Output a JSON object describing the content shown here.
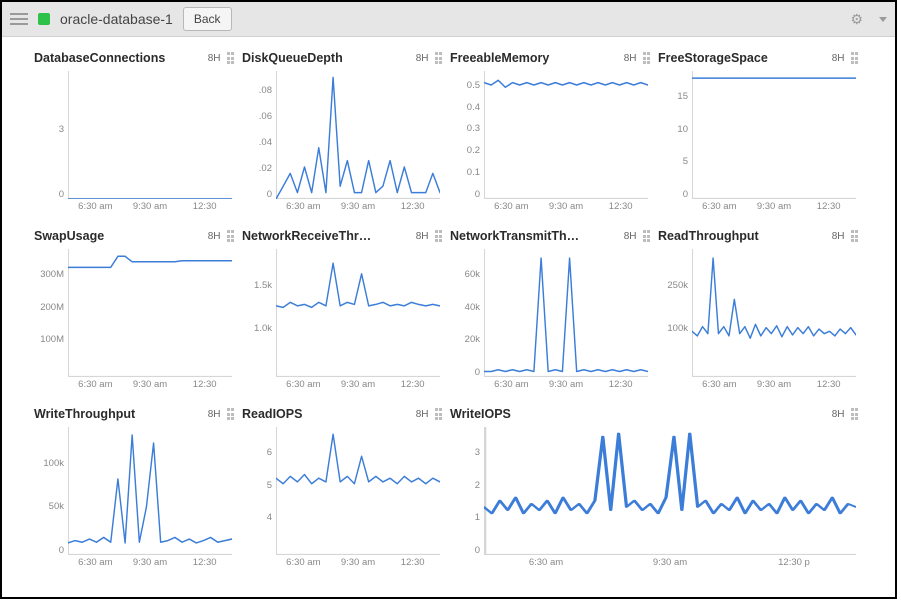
{
  "header": {
    "title": "oracle-database-1",
    "back_label": "Back"
  },
  "defaults": {
    "range_label": "8H",
    "x_ticks": [
      "6:30 am",
      "9:30 am",
      "12:30"
    ]
  },
  "chart_data": [
    {
      "id": "dbconn",
      "title": "DatabaseConnections",
      "type": "line",
      "xlabel": "",
      "ylabel": "",
      "ylim": [
        0,
        3
      ],
      "y_ticks": [
        "0",
        "3"
      ],
      "x_ticks": [
        "6:30 am",
        "9:30 am",
        "12:30"
      ],
      "x": [
        0,
        1,
        2,
        3,
        4,
        5,
        6,
        7,
        8,
        9,
        10,
        11,
        12,
        13,
        14,
        15,
        16,
        17,
        18,
        19,
        20,
        21,
        22,
        23
      ],
      "values": [
        0,
        0,
        0,
        0,
        0,
        0,
        0,
        0,
        0,
        0,
        0,
        0,
        0,
        0,
        0,
        0,
        0,
        0,
        0,
        0,
        0,
        0,
        0,
        0
      ]
    },
    {
      "id": "dqd",
      "title": "DiskQueueDepth",
      "type": "line",
      "xlabel": "",
      "ylabel": "",
      "ylim": [
        0,
        0.1
      ],
      "y_ticks": [
        "0",
        ".02",
        ".04",
        ".06",
        ".08"
      ],
      "x_ticks": [
        "6:30 am",
        "9:30 am",
        "12:30"
      ],
      "x": [
        0,
        1,
        2,
        3,
        4,
        5,
        6,
        7,
        8,
        9,
        10,
        11,
        12,
        13,
        14,
        15,
        16,
        17,
        18,
        19,
        20,
        21,
        22,
        23
      ],
      "values": [
        0.0,
        0.01,
        0.02,
        0.005,
        0.025,
        0.005,
        0.04,
        0.005,
        0.095,
        0.01,
        0.03,
        0.005,
        0.005,
        0.03,
        0.005,
        0.01,
        0.03,
        0.005,
        0.025,
        0.005,
        0.005,
        0.005,
        0.02,
        0.005
      ]
    },
    {
      "id": "freemem",
      "title": "FreeableMemory",
      "type": "line",
      "xlabel": "",
      "ylabel": "",
      "ylim": [
        0,
        0.55
      ],
      "y_ticks": [
        "0",
        "0.1",
        "0.2",
        "0.3",
        "0.4",
        "0.5"
      ],
      "x_ticks": [
        "6:30 am",
        "9:30 am",
        "12:30"
      ],
      "x": [
        0,
        1,
        2,
        3,
        4,
        5,
        6,
        7,
        8,
        9,
        10,
        11,
        12,
        13,
        14,
        15,
        16,
        17,
        18,
        19,
        20,
        21,
        22,
        23
      ],
      "values": [
        0.5,
        0.49,
        0.51,
        0.48,
        0.5,
        0.49,
        0.5,
        0.49,
        0.5,
        0.49,
        0.5,
        0.49,
        0.5,
        0.49,
        0.5,
        0.49,
        0.5,
        0.49,
        0.5,
        0.49,
        0.5,
        0.49,
        0.5,
        0.49
      ]
    },
    {
      "id": "freestor",
      "title": "FreeStorageSpace",
      "type": "line",
      "xlabel": "",
      "ylabel": "",
      "ylim": [
        0,
        18
      ],
      "y_ticks": [
        "0",
        "5",
        "10",
        "15"
      ],
      "x_ticks": [
        "6:30 am",
        "9:30 am",
        "12:30"
      ],
      "x": [
        0,
        1,
        2,
        3,
        4,
        5,
        6,
        7,
        8,
        9,
        10,
        11,
        12,
        13,
        14,
        15,
        16,
        17,
        18,
        19,
        20,
        21,
        22,
        23
      ],
      "values": [
        17,
        17,
        17,
        17,
        17,
        17,
        17,
        17,
        17,
        17,
        17,
        17,
        17,
        17,
        17,
        17,
        17,
        17,
        17,
        17,
        17,
        17,
        17,
        17
      ]
    },
    {
      "id": "swap",
      "title": "SwapUsage",
      "type": "line",
      "xlabel": "",
      "ylabel": "",
      "ylim": [
        0,
        350000000
      ],
      "y_ticks": [
        "",
        "100M",
        "200M",
        "300M"
      ],
      "x_ticks": [
        "6:30 am",
        "9:30 am",
        "12:30"
      ],
      "x": [
        0,
        1,
        2,
        3,
        4,
        5,
        6,
        7,
        8,
        9,
        10,
        11,
        12,
        13,
        14,
        15,
        16,
        17,
        18,
        19,
        20,
        21,
        22,
        23
      ],
      "values": [
        300000000,
        300000000,
        300000000,
        300000000,
        300000000,
        300000000,
        300000000,
        330000000,
        330000000,
        315000000,
        315000000,
        315000000,
        315000000,
        315000000,
        315000000,
        315000000,
        318000000,
        318000000,
        318000000,
        318000000,
        318000000,
        318000000,
        318000000,
        318000000
      ]
    },
    {
      "id": "netrx",
      "title": "NetworkReceiveThr…",
      "type": "line",
      "xlabel": "",
      "ylabel": "",
      "ylim": [
        0,
        1800
      ],
      "y_ticks": [
        "",
        "1.0k",
        "1.5k"
      ],
      "x_ticks": [
        "6:30 am",
        "9:30 am",
        "12:30"
      ],
      "x": [
        0,
        1,
        2,
        3,
        4,
        5,
        6,
        7,
        8,
        9,
        10,
        11,
        12,
        13,
        14,
        15,
        16,
        17,
        18,
        19,
        20,
        21,
        22,
        23
      ],
      "values": [
        1000,
        980,
        1050,
        1000,
        1020,
        980,
        1050,
        1000,
        1600,
        1000,
        1050,
        1020,
        1450,
        1000,
        1020,
        1050,
        1000,
        1020,
        1000,
        1050,
        1020,
        1000,
        1020,
        1000
      ]
    },
    {
      "id": "nettx",
      "title": "NetworkTransmitTh…",
      "type": "line",
      "xlabel": "",
      "ylabel": "",
      "ylim": [
        0,
        70000
      ],
      "y_ticks": [
        "0",
        "20k",
        "40k",
        "60k"
      ],
      "x_ticks": [
        "6:30 am",
        "9:30 am",
        "12:30"
      ],
      "x": [
        0,
        1,
        2,
        3,
        4,
        5,
        6,
        7,
        8,
        9,
        10,
        11,
        12,
        13,
        14,
        15,
        16,
        17,
        18,
        19,
        20,
        21,
        22,
        23
      ],
      "values": [
        3000,
        3000,
        4000,
        3000,
        4000,
        3000,
        4000,
        3000,
        65000,
        3000,
        4000,
        3000,
        65000,
        3000,
        4000,
        3000,
        4000,
        3000,
        4000,
        3000,
        4000,
        3000,
        4000,
        3000
      ]
    },
    {
      "id": "readtp",
      "title": "ReadThroughput",
      "type": "line",
      "xlabel": "",
      "ylabel": "",
      "ylim": [
        0,
        280000
      ],
      "y_ticks": [
        "",
        "100k",
        "250k"
      ],
      "x_ticks": [
        "6:30 am",
        "9:30 am",
        "12:30"
      ],
      "x": [
        0,
        1,
        2,
        3,
        4,
        5,
        6,
        7,
        8,
        9,
        10,
        11,
        12,
        13,
        14,
        15,
        16,
        17,
        18,
        19,
        20,
        21,
        22,
        23,
        24,
        25,
        26,
        27,
        28,
        29,
        30,
        31
      ],
      "values": [
        100000,
        90000,
        110000,
        95000,
        260000,
        95000,
        110000,
        90000,
        170000,
        95000,
        110000,
        85000,
        115000,
        90000,
        108000,
        95000,
        112000,
        88000,
        110000,
        92000,
        108000,
        95000,
        110000,
        90000,
        105000,
        95000,
        100000,
        90000,
        105000,
        95000,
        108000,
        92000
      ]
    },
    {
      "id": "writetp",
      "title": "WriteThroughput",
      "type": "line",
      "xlabel": "",
      "ylabel": "",
      "ylim": [
        0,
        160000
      ],
      "y_ticks": [
        "0",
        "50k",
        "100k"
      ],
      "x_ticks": [
        "6:30 am",
        "9:30 am",
        "12:30"
      ],
      "x": [
        0,
        1,
        2,
        3,
        4,
        5,
        6,
        7,
        8,
        9,
        10,
        11,
        12,
        13,
        14,
        15,
        16,
        17,
        18,
        19,
        20,
        21,
        22,
        23
      ],
      "values": [
        15000,
        18000,
        16000,
        20000,
        16000,
        22000,
        16000,
        95000,
        15000,
        150000,
        16000,
        60000,
        140000,
        16000,
        18000,
        22000,
        16000,
        20000,
        15000,
        18000,
        22000,
        16000,
        18000,
        20000
      ]
    },
    {
      "id": "readiops",
      "title": "ReadIOPS",
      "type": "line",
      "xlabel": "",
      "ylabel": "",
      "ylim": [
        0,
        7
      ],
      "y_ticks": [
        "",
        "4",
        "5",
        "6"
      ],
      "x_ticks": [
        "6:30 am",
        "9:30 am",
        "12:30"
      ],
      "x": [
        0,
        1,
        2,
        3,
        4,
        5,
        6,
        7,
        8,
        9,
        10,
        11,
        12,
        13,
        14,
        15,
        16,
        17,
        18,
        19,
        20,
        21,
        22,
        23
      ],
      "values": [
        4.2,
        3.9,
        4.3,
        4.0,
        4.4,
        3.9,
        4.2,
        4.0,
        6.6,
        4.0,
        4.3,
        3.9,
        5.4,
        4.0,
        4.3,
        4.0,
        4.2,
        3.9,
        4.3,
        4.0,
        4.2,
        3.9,
        4.2,
        4.0
      ]
    },
    {
      "id": "writeiops",
      "title": "WriteIOPS",
      "type": "line",
      "xlabel": "",
      "ylabel": "",
      "ylim": [
        0,
        4
      ],
      "y_ticks": [
        "0",
        "1",
        "2",
        "3"
      ],
      "x_ticks": [
        "6:30 am",
        "9:30 am",
        "12:30 p"
      ],
      "wide": true,
      "x": [
        0,
        1,
        2,
        3,
        4,
        5,
        6,
        7,
        8,
        9,
        10,
        11,
        12,
        13,
        14,
        15,
        16,
        17,
        18,
        19,
        20,
        21,
        22,
        23,
        24,
        25,
        26,
        27,
        28,
        29,
        30,
        31,
        32,
        33,
        34,
        35,
        36,
        37,
        38,
        39,
        40,
        41,
        42,
        43,
        44,
        45,
        46,
        47
      ],
      "values": [
        1.5,
        1.3,
        1.7,
        1.4,
        1.8,
        1.3,
        1.6,
        1.4,
        1.7,
        1.3,
        1.8,
        1.4,
        1.6,
        1.3,
        1.7,
        3.7,
        1.4,
        3.8,
        1.5,
        1.7,
        1.4,
        1.6,
        1.3,
        1.8,
        3.7,
        1.4,
        3.8,
        1.5,
        1.7,
        1.3,
        1.6,
        1.4,
        1.8,
        1.3,
        1.7,
        1.4,
        1.6,
        1.3,
        1.8,
        1.4,
        1.7,
        1.3,
        1.6,
        1.4,
        1.8,
        1.3,
        1.6,
        1.5
      ]
    }
  ]
}
